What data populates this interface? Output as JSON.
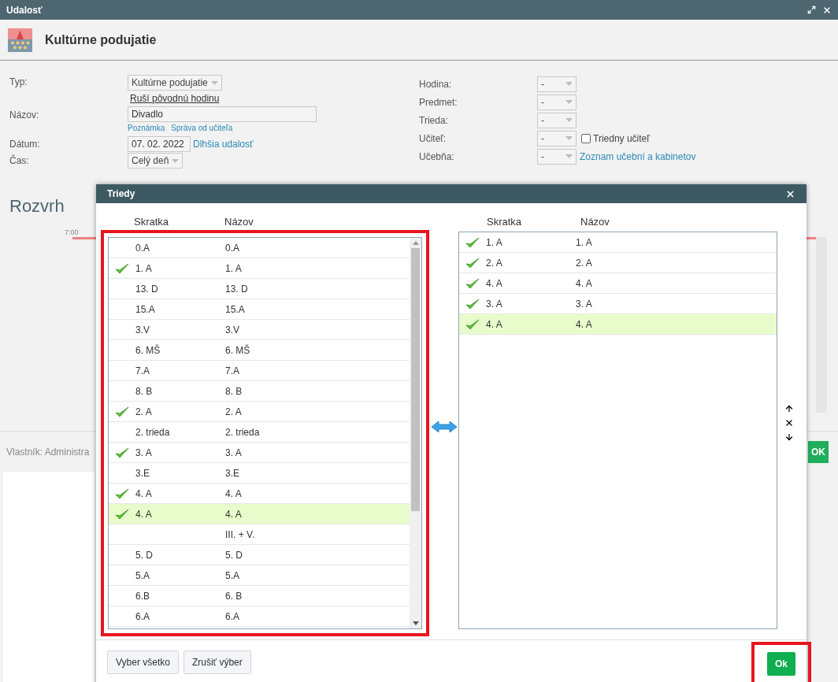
{
  "window": {
    "title": "Udalosť"
  },
  "header": {
    "title": "Kultúrne podujatie"
  },
  "type_field": {
    "label": "Typ:",
    "value": "Kultúrne podujatie",
    "link": "Ruší pôvodnú hodinu"
  },
  "name_field": {
    "label": "Názov:",
    "value": "Divadlo",
    "links": [
      "Poznámka",
      "Správa od učiteľa"
    ]
  },
  "date_field": {
    "label": "Dátum:",
    "value": "07. 02. 2022",
    "link": "Dlhšia udalosť"
  },
  "time_field": {
    "label": "Čas:",
    "value": "Celý deň"
  },
  "right_fields": [
    {
      "label": "Hodina:",
      "value": "-"
    },
    {
      "label": "Predmet:",
      "value": "-"
    },
    {
      "label": "Trieda:",
      "value": "-"
    },
    {
      "label": "Učiteľ:",
      "value": "-",
      "checkbox": {
        "label": "Triedny učiteľ",
        "checked": false
      }
    },
    {
      "label": "Učebňa:",
      "value": "-",
      "link": "Zoznam učební a kabinetov"
    }
  ],
  "schedule": {
    "title": "Rozvrh",
    "time": "7:00"
  },
  "footer": {
    "owner": "Vlastník: Administra",
    "ok": "OK"
  },
  "dialog": {
    "title": "Triedy",
    "left_columns": [
      "Skratka",
      "Názov"
    ],
    "left_list": {
      "highlighted": true,
      "rows": [
        {
          "code": "0.A",
          "name": "0.A",
          "checked": false,
          "selected": false
        },
        {
          "code": "1. A",
          "name": "1. A",
          "checked": true,
          "selected": false
        },
        {
          "code": "13. D",
          "name": "13. D",
          "checked": false,
          "selected": false
        },
        {
          "code": "15.A",
          "name": "15.A",
          "checked": false,
          "selected": false
        },
        {
          "code": "3.V",
          "name": "3.V",
          "checked": false,
          "selected": false
        },
        {
          "code": "6. MŠ",
          "name": "6. MŠ",
          "checked": false,
          "selected": false
        },
        {
          "code": "7.A",
          "name": "7.A",
          "checked": false,
          "selected": false
        },
        {
          "code": "8. B",
          "name": "8. B",
          "checked": false,
          "selected": false
        },
        {
          "code": "2. A",
          "name": "2. A",
          "checked": true,
          "selected": false
        },
        {
          "code": "2. trieda",
          "name": "2. trieda",
          "checked": false,
          "selected": false
        },
        {
          "code": "3. A",
          "name": "3. A",
          "checked": true,
          "selected": false
        },
        {
          "code": "3.E",
          "name": "3.E",
          "checked": false,
          "selected": false
        },
        {
          "code": "4. A",
          "name": "4. A",
          "checked": true,
          "selected": false
        },
        {
          "code": "4. A",
          "name": "4. A",
          "checked": true,
          "selected": true
        },
        {
          "name": "III. + V.",
          "checked": false,
          "selected": false
        },
        {
          "code": "5. D",
          "name": "5. D",
          "checked": false,
          "selected": false
        },
        {
          "code": "5.A",
          "name": "5.A",
          "checked": false,
          "selected": false
        },
        {
          "code": "6.B",
          "name": "6. B",
          "checked": false,
          "selected": false
        },
        {
          "code": "6.A",
          "name": "6.A",
          "checked": false,
          "selected": false
        }
      ]
    },
    "right_columns": [
      "Skratka",
      "Názov"
    ],
    "right_list": {
      "highlighted": false,
      "rows": [
        {
          "code": "1. A",
          "name": "1. A",
          "checked": true,
          "selected": false
        },
        {
          "code": "2. A",
          "name": "2. A",
          "checked": true,
          "selected": false
        },
        {
          "code": "4. A",
          "name": "4. A",
          "checked": true,
          "selected": false
        },
        {
          "code": "3. A",
          "name": "3. A",
          "checked": true,
          "selected": false
        },
        {
          "code": "4. A",
          "name": "4. A",
          "checked": true,
          "selected": true
        }
      ]
    },
    "buttons": [
      "Vyber všetko",
      "Zrušiť výber"
    ],
    "ok": {
      "label": "Ok",
      "highlighted": true
    }
  }
}
